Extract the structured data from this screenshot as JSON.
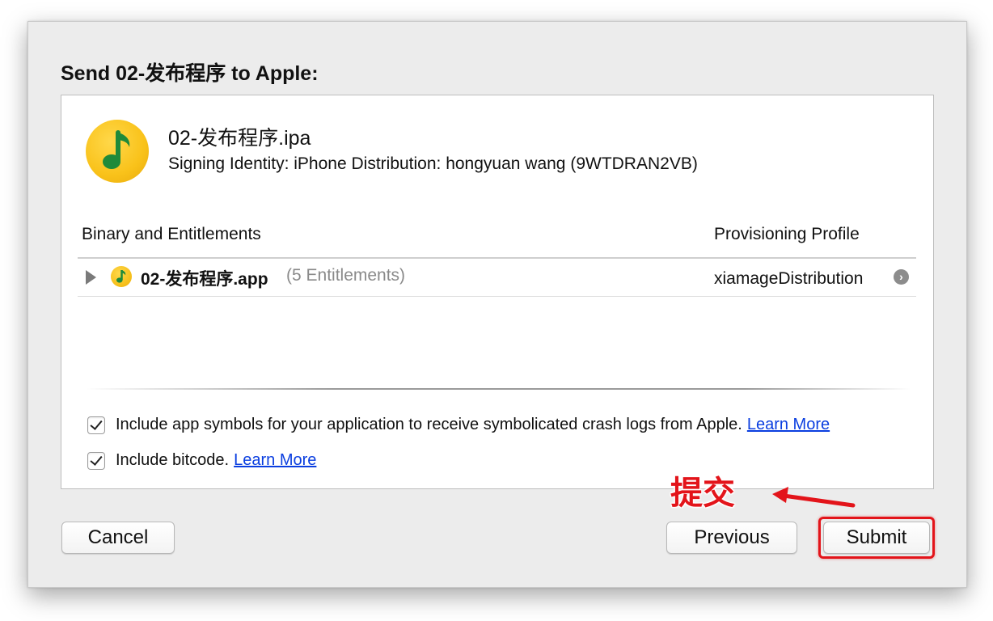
{
  "dialog": {
    "title": "Send 02-发布程序 to Apple:"
  },
  "package": {
    "ipa_name": "02-发布程序.ipa",
    "signing_identity": "Signing Identity: iPhone Distribution: hongyuan wang (9WTDRAN2VB)",
    "icon": "music-note-app-icon"
  },
  "table": {
    "columns": [
      "Binary and Entitlements",
      "Provisioning Profile"
    ],
    "rows": [
      {
        "app_name": "02-发布程序.app",
        "entitlements": "(5 Entitlements)",
        "profile": "xiamageDistribution"
      }
    ]
  },
  "options": [
    {
      "label": "Include app symbols for your application to receive symbolicated crash logs from Apple.",
      "checked": true,
      "link": "Learn More"
    },
    {
      "label": "Include bitcode.",
      "checked": true,
      "link": "Learn More"
    }
  ],
  "buttons": {
    "cancel": "Cancel",
    "previous": "Previous",
    "submit": "Submit"
  },
  "annotation": {
    "text": "提交",
    "color": "#e3141a"
  }
}
